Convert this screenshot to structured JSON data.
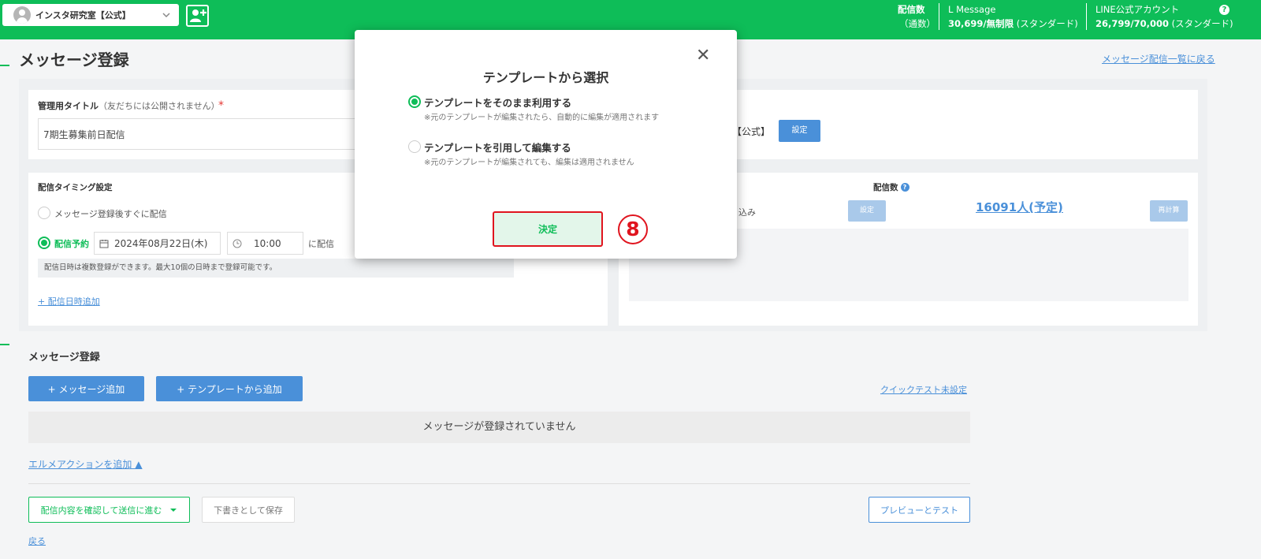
{
  "colors": {
    "brand_green": "#0ebd58",
    "link_blue": "#4a90d9",
    "highlight_red": "#e0141e"
  },
  "header": {
    "account_name": "インスタ研究室【公式】",
    "delivery": {
      "label": "配信数",
      "unit": "（通数）"
    },
    "lmessage": {
      "name": "L Message",
      "value": "30,699/無制限",
      "plan": " (スタンダード)"
    },
    "line_account": {
      "name": "LINE公式アカウント",
      "value": "26,799/70,000",
      "plan": " (スタンダード)",
      "help": "?"
    }
  },
  "page": {
    "title": "メッセージ登録",
    "back_link": "メッセージ配信一覧に戻る"
  },
  "admin_title": {
    "label": "管理用タイトル",
    "note": "（友だちには公開されません）",
    "required_mark": "*",
    "value": "7期生募集前日配信"
  },
  "sender": {
    "account_partial": "【公式】",
    "set_button": "設定"
  },
  "timing": {
    "heading": "配信タイミング設定",
    "immediate": "メッセージ登録後すぐに配信",
    "scheduled": "配信予約",
    "date": "2024年08月22日(木)",
    "time": "10:00",
    "suffix": "に配信",
    "note": "配信日時は複数登録ができます。最大10個の日時まで登録可能です。",
    "add_link": "+ 配信日時追加"
  },
  "audience": {
    "filter_partial": "り込み",
    "filter_button": "設定",
    "count_label": "配信数",
    "count_help": "?",
    "count_value": "16091人(予定)",
    "recalc_button": "再計算"
  },
  "messages": {
    "section_title": "メッセージ登録",
    "add_message": "+ メッセージ追加",
    "add_template": "+ テンプレートから追加",
    "quick_test": "クイックテスト未設定",
    "empty": "メッセージが登録されていません",
    "action_link": "エルメアクションを追加 ▲"
  },
  "footer": {
    "confirm": "配信内容を確認して送信に進む",
    "draft": "下書きとして保存",
    "preview": "プレビューとテスト",
    "back": "戻る"
  },
  "modal": {
    "title": "テンプレートから選択",
    "close": "✕",
    "option1": {
      "label": "テンプレートをそのまま利用する",
      "note": "※元のテンプレートが編集されたら、自動的に編集が適用されます",
      "selected": true
    },
    "option2": {
      "label": "テンプレートを引用して編集する",
      "note": "※元のテンプレートが編集されても、編集は適用されません",
      "selected": false
    },
    "confirm": "決定",
    "step": "8"
  }
}
